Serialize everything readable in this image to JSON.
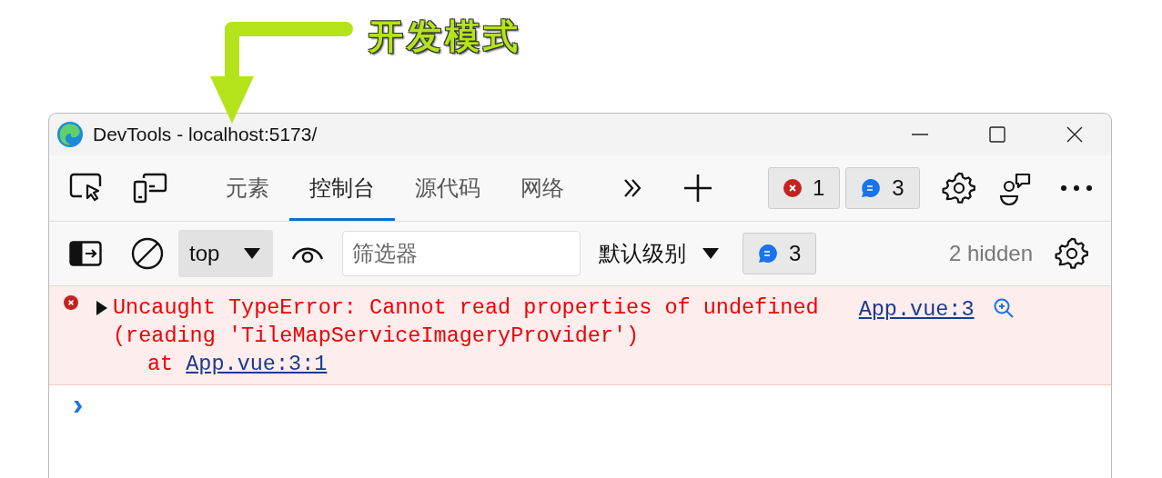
{
  "annotation": {
    "label": "开发模式"
  },
  "window": {
    "title": "DevTools - localhost:5173/"
  },
  "tabs": [
    {
      "label": "元素",
      "selected": false
    },
    {
      "label": "控制台",
      "selected": true
    },
    {
      "label": "源代码",
      "selected": false
    },
    {
      "label": "网络",
      "selected": false
    }
  ],
  "status": {
    "errors": "1",
    "messages": "3"
  },
  "console_toolbar": {
    "context": "top",
    "filter": {
      "placeholder": "筛选器"
    },
    "level": "默认级别",
    "messages": "3",
    "hidden": "2 hidden"
  },
  "messages": [
    {
      "kind": "error",
      "expanded": false,
      "text": "Uncaught TypeError: Cannot read properties of undefined\n(reading 'TileMapServiceImageryProvider')",
      "source": "App.vue:3",
      "stack": {
        "prefix": "at",
        "link": "App.vue:3:1"
      }
    }
  ],
  "prompt": {
    "symbol": "›"
  }
}
